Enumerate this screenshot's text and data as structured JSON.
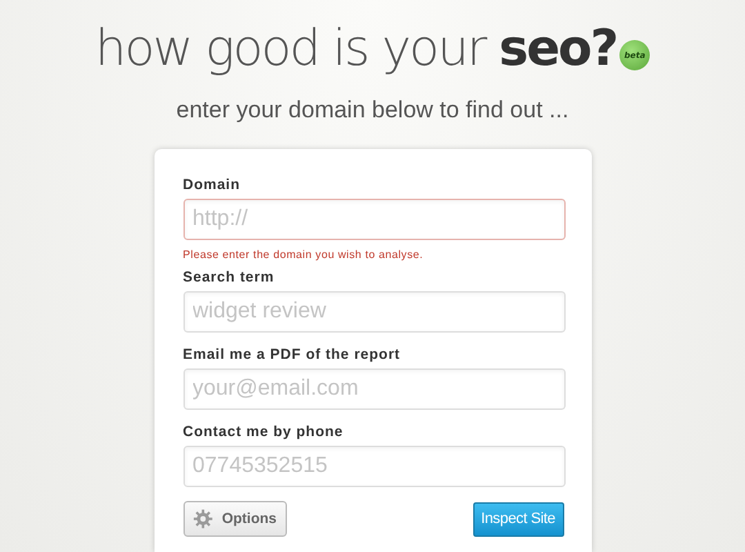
{
  "header": {
    "title": "how good is your **seo?**",
    "badge": "beta",
    "subtitle": "enter your domain below to find out ..."
  },
  "form": {
    "fields": [
      {
        "label": "Domain",
        "placeholder": "http://",
        "invalid": true,
        "error": "Please enter the domain you wish to analyse."
      },
      {
        "label": "Search term",
        "placeholder": "widget review",
        "invalid": false
      },
      {
        "label": "Email me a PDF of the report",
        "placeholder": "your@email.com",
        "invalid": false
      },
      {
        "label": "Contact me by phone",
        "placeholder": "07745352515",
        "invalid": false
      }
    ],
    "options_button": "Options",
    "submit_button": "Inspect Site"
  }
}
